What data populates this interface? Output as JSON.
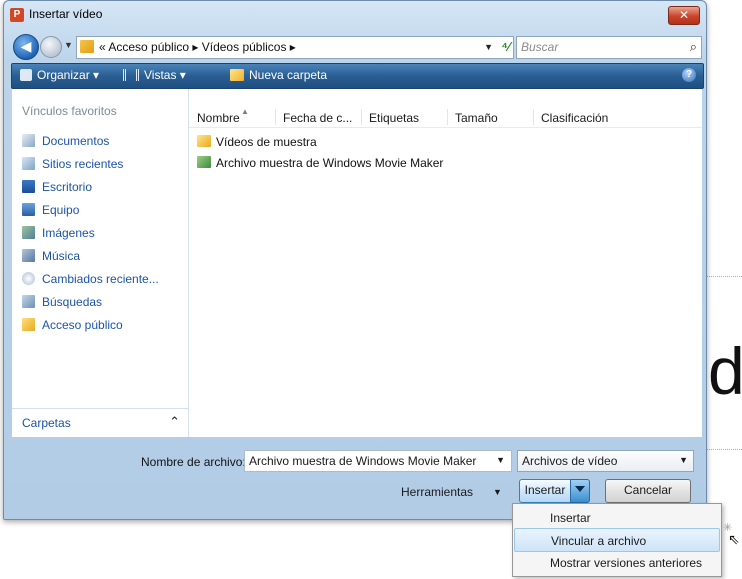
{
  "window": {
    "title": "Insertar vídeo",
    "app_icon": "P",
    "close_label": "✕"
  },
  "address_bar": {
    "path": "« Acceso público ▸ Vídeos públicos ▸",
    "search_placeholder": "Buscar"
  },
  "toolbar": {
    "organize": "Organizar ▾",
    "views": "Vistas ▾",
    "new_folder": "Nueva carpeta"
  },
  "nav_pane": {
    "header": "Vínculos favoritos",
    "items": [
      {
        "label": "Documentos",
        "icon": "documents-icon"
      },
      {
        "label": "Sitios recientes",
        "icon": "recent-places-icon"
      },
      {
        "label": "Escritorio",
        "icon": "desktop-icon"
      },
      {
        "label": "Equipo",
        "icon": "computer-icon"
      },
      {
        "label": "Imágenes",
        "icon": "pictures-icon"
      },
      {
        "label": "Música",
        "icon": "music-icon"
      },
      {
        "label": "Cambiados reciente...",
        "icon": "recently-changed-icon"
      },
      {
        "label": "Búsquedas",
        "icon": "searches-icon"
      },
      {
        "label": "Acceso público",
        "icon": "public-folder-icon"
      }
    ],
    "folders_label": "Carpetas"
  },
  "file_list": {
    "columns": [
      "Nombre",
      "Fecha de c...",
      "Etiquetas",
      "Tamaño",
      "Clasificación"
    ],
    "rows": [
      {
        "name": "Vídeos de muestra",
        "icon": "folder-icon"
      },
      {
        "name": "Archivo muestra de Windows Movie Maker",
        "icon": "movie-file-icon"
      }
    ]
  },
  "bottom": {
    "filename_label": "Nombre de archivo:",
    "filename_value": "Archivo muestra de Windows Movie Maker",
    "filetype_value": "Archivos de vídeo",
    "tools_label": "Herramientas",
    "insert_label": "Insertar",
    "cancel_label": "Cancelar"
  },
  "insert_menu": {
    "items": [
      "Insertar",
      "Vincular a archivo",
      "Mostrar versiones anteriores"
    ],
    "hovered_index": 1
  },
  "background_slide": {
    "visible_char": "d"
  },
  "colors": {
    "toolbar_blue": "#2a5e93",
    "link_blue": "#1c53a8",
    "close_red": "#c9442a"
  }
}
